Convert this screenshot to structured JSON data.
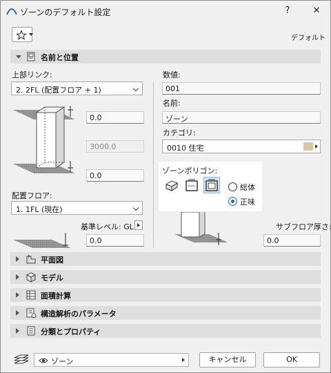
{
  "window": {
    "title": "ゾーンのデフォルト設定",
    "help_label": "?",
    "close_label": "✕"
  },
  "toolbar": {
    "default_label": "デフォルト"
  },
  "sections": {
    "name_position": "名前と位置",
    "floor_plan": "平面図",
    "model": "モデル",
    "area_calc": "面積計算",
    "structural": "構造解析のパラメータ",
    "classification": "分類とプロパティ"
  },
  "left": {
    "top_link_label": "上部リンク:",
    "top_link_value": "2. 2FL (配置フロア + 1)",
    "offset_top": "0.0",
    "height": "3000.0",
    "offset_bottom": "0.0",
    "home_story_label": "配置フロア:",
    "home_story_value": "1. 1FL (現在)",
    "ref_level_label": "基準レベル: GL",
    "ref_level_value": "0.0"
  },
  "right": {
    "number_label": "数値:",
    "number_value": "001",
    "name_label": "名前:",
    "name_value": "ゾーン",
    "category_label": "カテゴリ:",
    "category_value": "0010  住宅",
    "category_color": "#d9c7a3",
    "polygon_label": "ゾーンポリゴン:",
    "radio_gross": "総体",
    "radio_net": "正味",
    "selected_radio": "正味",
    "subfloor_label": "サブフロア厚さ:",
    "subfloor_value": "0.0"
  },
  "footer": {
    "layer_value": "ゾーン",
    "cancel_label": "キャンセル",
    "ok_label": "OK"
  }
}
